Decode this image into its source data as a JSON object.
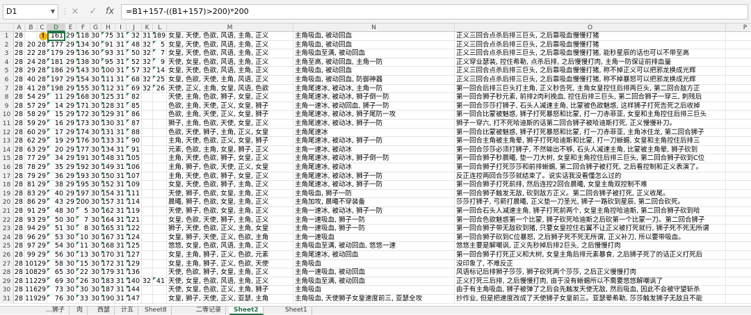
{
  "formula_bar": {
    "name_box": "D1",
    "cancel_icon": "×",
    "enter_icon": "✓",
    "fx_icon": "fx",
    "formula": "=B1+157-((B1+157)>200)*200"
  },
  "columns": [
    "A",
    "B",
    "C",
    "D",
    "E",
    "F",
    "G",
    "H",
    "I",
    "J",
    "K",
    "L",
    "M",
    "N",
    "O",
    "P"
  ],
  "selected_column": "D",
  "rows": [
    {
      "n": "1",
      "A": "28",
      "B": "",
      "C": "8",
      "D": "161",
      "E": "29",
      "F": "118",
      "G": "30",
      "H": "75",
      "I": "31",
      "J": "32",
      "K": "31",
      "L": "189",
      "M": "女皇, 天使, 色欲, 风语, 主角, 正义",
      "N": "主角吸血, 被动回血",
      "O": "正义三回合点杀后排三巨头, 之后靠吸血慢慢打猪"
    },
    {
      "n": "2",
      "A": "28",
      "B": "20",
      "C": "28",
      "D": "177",
      "E": "29",
      "F": "134",
      "G": "30",
      "H": "91",
      "I": "31",
      "J": "48",
      "K": "32",
      "L": "5",
      "M": "女皇, 天使, 色欲, 风语, 主角, 正义",
      "N": "主角吸血, 被动回血",
      "O": "正义三回合点杀后排三巨头, 之后靠吸血慢慢打猪"
    },
    {
      "n": "3",
      "A": "28",
      "B": "22",
      "C": "28",
      "D": "179",
      "E": "29",
      "F": "136",
      "G": "30",
      "H": "93",
      "I": "31",
      "J": "50",
      "K": "32",
      "L": "7",
      "M": "女皇, 天使, 色欲, 风语, 主角, 正义",
      "N": "主角吸血至满, 被动回血",
      "O": "正义三回合点杀后排三巨头, 之后靠吸血慢慢打猪, 能秒星辰的话也可以不带至高"
    },
    {
      "n": "4",
      "A": "28",
      "B": "24",
      "C": "28",
      "D": "181",
      "E": "29",
      "F": "138",
      "G": "30",
      "H": "95",
      "I": "31",
      "J": "52",
      "K": "32",
      "L": "9",
      "M": "天使, 女皇, 色欲, 风语, 主角, 正义",
      "N": "主角至高, 被动回血, 主角一防",
      "O": "正义穿业瑟装, 控住希勒, 点杀后排, 之后慢慢打肉, 主角一防保证前排血量"
    },
    {
      "n": "5",
      "A": "28",
      "B": "29",
      "C": "28",
      "D": "186",
      "E": "29",
      "F": "143",
      "G": "30",
      "H": "100",
      "I": "31",
      "J": "57",
      "K": "32",
      "L": "14",
      "M": "女皇, 天使, 色欲, 风语, 主角, 正义",
      "N": "主角吸血, 被动回血",
      "O": "正义三回合点杀后排三巨头, 之后靠吸血慢慢打猪, 称不掉正义可以把邪龙换成光辉"
    },
    {
      "n": "6",
      "A": "28",
      "B": "40",
      "C": "28",
      "D": "197",
      "E": "29",
      "F": "154",
      "G": "30",
      "H": "111",
      "I": "31",
      "J": "68",
      "K": "32",
      "L": "25",
      "M": "女皇, 色欲, 天使, 主角, 风语, 正义",
      "N": "主角吸血, 被动回血, 防御神器",
      "O": "正义三回合点杀后排三巨头, 之后靠吸血慢慢打猪, 称不掉暴怒可以把邪龙换成光辉"
    },
    {
      "n": "7",
      "A": "28",
      "B": "41",
      "C": "28",
      "D": "198",
      "E": "29",
      "F": "155",
      "G": "30",
      "H": "112",
      "I": "31",
      "J": "69",
      "K": "32",
      "L": "26",
      "M": "天使, 正义, 主角, 女皇, 风语, 色欲",
      "N": "主角尾速冰, 被动冰, 主角一防",
      "O": "第一回合后排三巨头打主角, 正义秒告死, 主角女皇控住后排两巨头, 第二回合敌方正"
    },
    {
      "n": "8",
      "A": "28",
      "B": "54",
      "C": "29",
      "D": "11",
      "E": "29",
      "F": "168",
      "G": "30",
      "H": "125",
      "I": "31",
      "J": "82",
      "K": "",
      "L": "",
      "M": "天使, 主角, 色欲, 狮子, 女皇, 正义",
      "N": "主角尾速冰, 被动冰, 狮子倒一防",
      "O": "第一回合狮子秒元素, 前排2肉利挽血, 控住后排三巨头, 第二回合狮子一穿三, 刺残后"
    },
    {
      "n": "9",
      "A": "28",
      "B": "57",
      "C": "29",
      "D": "14",
      "E": "29",
      "F": "171",
      "G": "30",
      "H": "128",
      "I": "31",
      "J": "85",
      "K": "",
      "L": "",
      "M": "色欲, 主角, 天使, 正义, 女皇, 狮子",
      "N": "主角一速冰, 被动回血, 狮子一防",
      "O": "第一回合莎莎打狮子, 石头人减速主角, 比蒙被色欲魅惑, 这样狮子打死告死之后收掉"
    },
    {
      "n": "10",
      "A": "28",
      "B": "58",
      "C": "29",
      "D": "15",
      "E": "29",
      "F": "172",
      "G": "30",
      "H": "129",
      "I": "31",
      "J": "86",
      "K": "",
      "L": "",
      "M": "色欲, 主角, 天使, 正义, 女皇, 狮子",
      "N": "主角尾速冰, 被动冰, 狮子尾防一攻",
      "O": "第一回合比蒙被魅惑, 狮子打死暴怒和比蒙, 打一刀赤菲亚, 女皇和主角控住后排三巨头"
    },
    {
      "n": "11",
      "A": "28",
      "B": "59",
      "C": "29",
      "D": "16",
      "E": "29",
      "F": "173",
      "G": "30",
      "H": "130",
      "I": "31",
      "J": "87",
      "K": "",
      "L": "",
      "M": "狮子, 主角, 色欲, 天使, 女皇, 正义",
      "N": "主角尾速冰, 被动冰, 狮子一防",
      "O": "狮子一穿六, 打不死哈迪斯的话第二回合狮子被哈迪斯打死, 正义慢慢补刀。"
    },
    {
      "n": "12",
      "A": "28",
      "B": "60",
      "C": "29",
      "D": "17",
      "E": "29",
      "F": "174",
      "G": "30",
      "H": "131",
      "I": "31",
      "J": "88",
      "K": "",
      "L": "",
      "M": "色欲, 天使, 狮子, 主角, 正义, 女皇",
      "N": "主角尾速冰",
      "O": "第一回合比蒙被魅惑, 狮子打死暴怒和比蒙, 打一刀赤菲亚, 主角冰住龙, 第二回合狮子"
    },
    {
      "n": "13",
      "A": "28",
      "B": "62",
      "C": "29",
      "D": "19",
      "E": "29",
      "F": "176",
      "G": "30",
      "H": "133",
      "I": "31",
      "J": "90",
      "K": "",
      "L": "",
      "M": "主角, 天使, 色欲, 正义, 女皇, 狮子",
      "N": "主角尾速冰, 被动冰, 狮子一防",
      "O": "第一回合主角被主角晕, 狮子打死哈迪斯和比蒙, 打一刀蜥蜴, 女皇和主角控住后排三"
    },
    {
      "n": "14",
      "A": "28",
      "B": "63",
      "C": "29",
      "D": "20",
      "E": "29",
      "F": "177",
      "G": "30",
      "H": "134",
      "I": "31",
      "J": "91",
      "K": "",
      "L": "",
      "M": "元素, 色欲, 主角, 女皇, 狮子, 正义",
      "N": "主角一速冰, 被动冰",
      "O": "第一回合莎莎必须打狮子, 不然输出不够, 石头人减速主角, 比蒙被主角晕, 狮子砍到"
    },
    {
      "n": "15",
      "A": "28",
      "B": "77",
      "C": "29",
      "D": "34",
      "E": "29",
      "F": "191",
      "G": "30",
      "H": "148",
      "I": "31",
      "J": "105",
      "K": "",
      "L": "",
      "M": "主角, 天使, 色欲, 狮子, 女皇, 正义",
      "N": "主角尾速冰, 被动冰, 狮子倒一防",
      "O": "第一回合狮子秒晨曦, 垫一刀大树, 女皇和主角控住后排三巨头, 第二回合狮子砍到C位"
    },
    {
      "n": "16",
      "A": "28",
      "B": "78",
      "C": "29",
      "D": "35",
      "E": "29",
      "F": "192",
      "G": "30",
      "H": "149",
      "I": "31",
      "J": "106",
      "K": "",
      "L": "",
      "M": "主角, 狮子, 色欲, 天使, 正义, 女皇",
      "N": "主角尾速冰, 被动冰",
      "O": "第一回合狮子打死莎莎和前排蜥蜴, 第二回合狮子被打死, 之后看控制和正义表演了。"
    },
    {
      "n": "17",
      "A": "28",
      "B": "79",
      "C": "29",
      "D": "36",
      "E": "29",
      "F": "193",
      "G": "30",
      "H": "150",
      "I": "31",
      "J": "107",
      "K": "",
      "L": "",
      "M": "主角, 天使, 色欲, 狮子, 女皇, 正义",
      "N": "主角尾速冰, 被动冰, 狮子一防",
      "O": "反正连控两回合莎莎就结束了。说实话我没看懂怎么过的"
    },
    {
      "n": "18",
      "A": "28",
      "B": "81",
      "C": "29",
      "D": "38",
      "E": "29",
      "F": "195",
      "G": "30",
      "H": "152",
      "I": "31",
      "J": "109",
      "K": "",
      "L": "",
      "M": "女皇, 天使, 色欲, 狮子, 主角, 正义",
      "N": "主角尾速冰, 被动冰, 狮子一防",
      "O": "第一回合狮子打死前排, 然后连控2回合晨曦, 女皇主角双控制不难"
    },
    {
      "n": "19",
      "A": "28",
      "B": "83",
      "C": "29",
      "D": "40",
      "E": "29",
      "F": "197",
      "G": "30",
      "H": "154",
      "I": "31",
      "J": "111",
      "K": "",
      "L": "",
      "M": "天使, 狮子, 色欲, 女皇, 主角, 正义",
      "N": "主角吸血, 狮子一防",
      "O": "第一回合狮子触发无敌, 砍到敌方正义。第二回合狮子被打死, 正义收尾。"
    },
    {
      "n": "20",
      "A": "28",
      "B": "86",
      "C": "29",
      "D": "43",
      "E": "29",
      "F": "200",
      "G": "30",
      "H": "157",
      "I": "31",
      "J": "114",
      "K": "",
      "L": "",
      "M": "晨曦, 狮子, 色欲, 女皇, 主角, 正义",
      "N": "主角加攻, 晨曦不穿装备",
      "O": "莎莎打狮子, 弓箭打晨曦, 正义垫一刀圣光, 狮子一路砍到星辰, 第二回合砍死。"
    },
    {
      "n": "21",
      "A": "28",
      "B": "91",
      "C": "29",
      "D": "48",
      "E": "30",
      "F": "5",
      "G": "30",
      "H": "162",
      "I": "31",
      "J": "119",
      "K": "",
      "L": "",
      "M": "天使, 狮子, 色欲, 女皇, 主角, 正义",
      "N": "主角一速冰, 被动冰, 狮子一防",
      "O": "第一回合石头人减速主角, 狮子打死前两个, 女皇主角控哈迪斯, 第二回合狮子砍到哈"
    },
    {
      "n": "22",
      "A": "28",
      "B": "93",
      "C": "29",
      "D": "50",
      "E": "30",
      "F": "7",
      "G": "30",
      "H": "164",
      "I": "31",
      "J": "121",
      "K": "",
      "L": "",
      "M": "女皇, 色欲, 天使, 狮子, 主角, 正义",
      "N": "主角一速吸血, 狮子一防",
      "O": "第一回合色欲魅惑第一个比蒙, 狮子砍死哈迪斯之后砍第一个比蒙一刀。第二回合狮子"
    },
    {
      "n": "23",
      "A": "28",
      "B": "94",
      "C": "29",
      "D": "51",
      "E": "30",
      "F": "8",
      "G": "30",
      "H": "165",
      "I": "31",
      "J": "122",
      "K": "",
      "L": "",
      "M": "狮子, 天使, 色欲, 正义, 主角, 女皇",
      "N": "主角一速吸血, 狮子一防",
      "O": "第一回合狮子带无敌砍到猪, 只要女皇控住右翼不让正义被打死就行, 狮子死不死无所谓"
    },
    {
      "n": "24",
      "A": "28",
      "B": "96",
      "C": "29",
      "D": "53",
      "E": "30",
      "F": "10",
      "G": "30",
      "H": "167",
      "I": "31",
      "J": "124",
      "K": "",
      "L": "",
      "M": "女皇, 狮子, 天使, 正义, 色欲, 主角",
      "N": "主角一速吸血",
      "O": "第一回合狮子砍到C位暴怒, 之后狮子死不死无所谓, 正义补刀, 所以要带吸血。"
    },
    {
      "n": "25",
      "A": "28",
      "B": "97",
      "C": "29",
      "D": "54",
      "E": "30",
      "F": "11",
      "G": "30",
      "H": "168",
      "I": "31",
      "J": "125",
      "K": "",
      "L": "",
      "M": "悠悠, 女皇, 色欲, 风语, 主角, 正义",
      "N": "主角吸血至满, 被动回血, 悠悠一速",
      "O": "悠悠主要是解嘲讽, 正义先秒掉后排2巨头, 之后慢慢打肉"
    },
    {
      "n": "26",
      "A": "28",
      "B": "99",
      "C": "29",
      "D": "56",
      "E": "30",
      "F": "13",
      "G": "30",
      "H": "170",
      "I": "31",
      "J": "127",
      "K": "",
      "L": "",
      "M": "女皇, 主角, 狮子, 正义, 色欲, 元素",
      "N": "主角尾速冰, 被动回血",
      "O": "第一回合狮子打死正义和大树, 女皇主角后排元素暴食, 之后狮子死了的话正义打死后"
    },
    {
      "n": "27",
      "A": "28",
      "B": "101",
      "C": "29",
      "D": "58",
      "E": "30",
      "F": "15",
      "G": "30",
      "H": "172",
      "I": "31",
      "J": "129",
      "K": "",
      "L": "",
      "M": "女皇, 主角, 狮子, 正义, 色欲, 天使",
      "N": "主角吸血",
      "O": "没印象了, 不难反正"
    },
    {
      "n": "28",
      "A": "28",
      "B": "108",
      "C": "29",
      "D": "65",
      "E": "30",
      "F": "22",
      "G": "30",
      "H": "179",
      "I": "31",
      "J": "136",
      "K": "",
      "L": "",
      "M": "天使, 色欲, 狮子, 女皇, 主角, 正义",
      "N": "主角一速吸血, 被动回血",
      "O": "风语标记后排狮子莎莎, 狮子砍死两个莎莎, 之后正义慢慢打肉"
    },
    {
      "n": "29",
      "A": "28",
      "B": "112",
      "C": "29",
      "D": "69",
      "E": "30",
      "F": "26",
      "G": "30",
      "H": "183",
      "I": "31",
      "J": "140",
      "K": "32",
      "L": "41",
      "M": "天使, 女皇, 色欲, 风语, 主角, 正义",
      "N": "主角吸血至满, 被动回血",
      "O": "正义打死三后排, 之后慢慢打肉, 由于没有蜥蜴所以不需要悠悠解嘲讽了"
    },
    {
      "n": "30",
      "A": "28",
      "B": "116",
      "C": "29",
      "D": "73",
      "E": "30",
      "F": "30",
      "G": "30",
      "H": "187",
      "I": "31",
      "J": "144",
      "K": "",
      "L": "",
      "M": "天使, 女皇, 色欲, 正义, 主角, 狮子",
      "N": "主角吸血",
      "O": "由于有主角吸血, 狮子被弹了之后会先触发天使无敌, 然后吸血, 因此不会被守望斩杀"
    },
    {
      "n": "31",
      "A": "28",
      "B": "119",
      "C": "29",
      "D": "76",
      "E": "30",
      "F": "33",
      "G": "30",
      "H": "190",
      "I": "31",
      "J": "147",
      "K": "",
      "L": "",
      "M": "女皇, 狮子, 天使, 正义, 亚瑟, 主角",
      "N": "主角吸血, 天使狮子女皇速度前三, 亚瑟全攻",
      "O": "抄作业, 但是把速度改成了天使狮子女皇前三。亚瑟晕希勒, 莎莎触发狮子无敌且不能"
    }
  ],
  "sheet_tabs": [
    "…狮子",
    "肉",
    "西瑟",
    "计五",
    "Sheet8",
    "二等记录",
    "Sheet2",
    "Sheet1"
  ],
  "active_tab": "Sheet2"
}
